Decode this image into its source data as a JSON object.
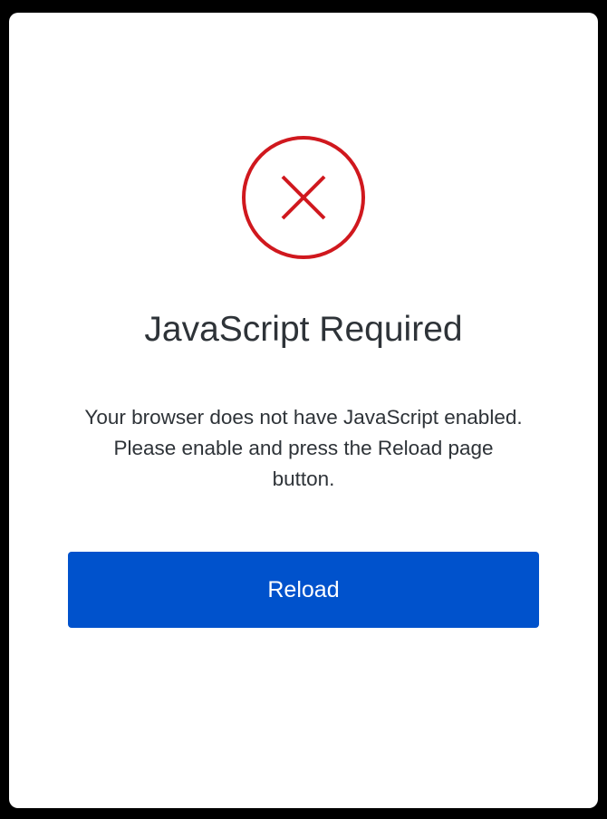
{
  "dialog": {
    "icon": "error-x-circle-icon",
    "title": "JavaScript Required",
    "message": "Your browser does not have JavaScript enabled. Please enable and press the Reload page button.",
    "reload_label": "Reload"
  },
  "colors": {
    "background": "#000000",
    "card": "#ffffff",
    "icon_red": "#d0181e",
    "text": "#2e3338",
    "button": "#0052cc",
    "button_text": "#ffffff"
  }
}
